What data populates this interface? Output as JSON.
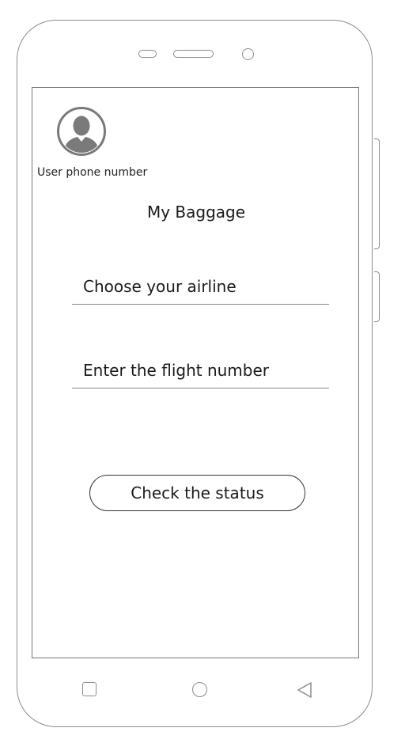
{
  "profile": {
    "avatar_icon": "user-avatar-icon",
    "phone_label": "User phone number"
  },
  "page": {
    "title": "My Baggage"
  },
  "form": {
    "airline_placeholder": "Choose your airline",
    "flight_placeholder": "Enter the flight number",
    "submit_label": "Check the status"
  },
  "navigation": {
    "recents_icon": "square-icon",
    "home_icon": "circle-icon",
    "back_icon": "back-triangle-icon"
  },
  "colors": {
    "outline": "#8c8c8c",
    "text": "#1a1a1a",
    "background": "#ffffff"
  }
}
